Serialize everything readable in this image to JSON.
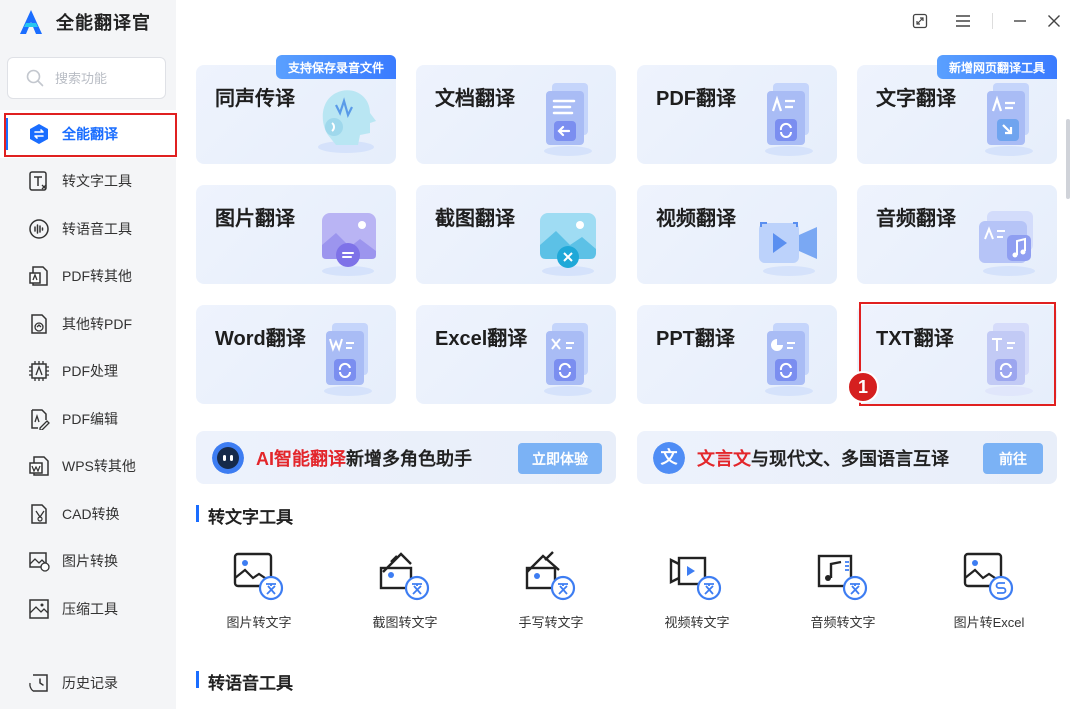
{
  "app": {
    "name": "全能翻译官"
  },
  "search": {
    "placeholder": "搜索功能"
  },
  "sidebar": {
    "items": [
      {
        "label": "全能翻译",
        "icon": "swap-icon",
        "active": true
      },
      {
        "label": "转文字工具",
        "icon": "text-convert-icon"
      },
      {
        "label": "转语音工具",
        "icon": "voice-icon"
      },
      {
        "label": "PDF转其他",
        "icon": "pdf-export-icon"
      },
      {
        "label": "其他转PDF",
        "icon": "pdf-import-icon"
      },
      {
        "label": "PDF处理",
        "icon": "pdf-process-icon"
      },
      {
        "label": "PDF编辑",
        "icon": "pdf-edit-icon"
      },
      {
        "label": "WPS转其他",
        "icon": "wps-icon"
      },
      {
        "label": "CAD转换",
        "icon": "cad-icon"
      },
      {
        "label": "图片转换",
        "icon": "image-convert-icon"
      },
      {
        "label": "压缩工具",
        "icon": "compress-icon"
      }
    ],
    "history": "历史记录"
  },
  "cards": [
    {
      "title": "同声传译",
      "tag": "支持保存录音文件",
      "icon": "head-voice-icon"
    },
    {
      "title": "文档翻译",
      "icon": "document-icon"
    },
    {
      "title": "PDF翻译",
      "icon": "pdf-doc-icon"
    },
    {
      "title": "文字翻译",
      "tag": "新增网页翻译工具",
      "icon": "text-doc-icon"
    },
    {
      "title": "图片翻译",
      "icon": "picture-icon"
    },
    {
      "title": "截图翻译",
      "icon": "screenshot-icon"
    },
    {
      "title": "视频翻译",
      "icon": "video-icon"
    },
    {
      "title": "音频翻译",
      "icon": "audio-icon"
    },
    {
      "title": "Word翻译",
      "icon": "word-icon"
    },
    {
      "title": "Excel翻译",
      "icon": "excel-icon"
    },
    {
      "title": "PPT翻译",
      "icon": "ppt-icon"
    },
    {
      "title": "TXT翻译",
      "icon": "txt-icon"
    }
  ],
  "step_badge": "1",
  "banners": [
    {
      "highlight": "AI智能翻译",
      "text": "新增多角色助手",
      "button": "立即体验",
      "icon": "robot-icon"
    },
    {
      "highlight": "文言文",
      "text": "与现代文、多国语言互译",
      "button": "前往",
      "icon": "wen-icon",
      "icon_text": "文"
    }
  ],
  "sections": [
    {
      "title": "转文字工具"
    },
    {
      "title": "转语音工具"
    }
  ],
  "tools": [
    {
      "label": "图片转文字",
      "icon": "image-to-text-icon"
    },
    {
      "label": "截图转文字",
      "icon": "screenshot-to-text-icon"
    },
    {
      "label": "手写转文字",
      "icon": "handwriting-to-text-icon"
    },
    {
      "label": "视频转文字",
      "icon": "video-to-text-icon"
    },
    {
      "label": "音频转文字",
      "icon": "audio-to-text-icon"
    },
    {
      "label": "图片转Excel",
      "icon": "image-to-excel-icon"
    }
  ],
  "colors": {
    "accent": "#1a6dff",
    "highlight_red": "#e3262b",
    "annotation_red": "#e02020",
    "button_blue": "#7bb2f5"
  }
}
